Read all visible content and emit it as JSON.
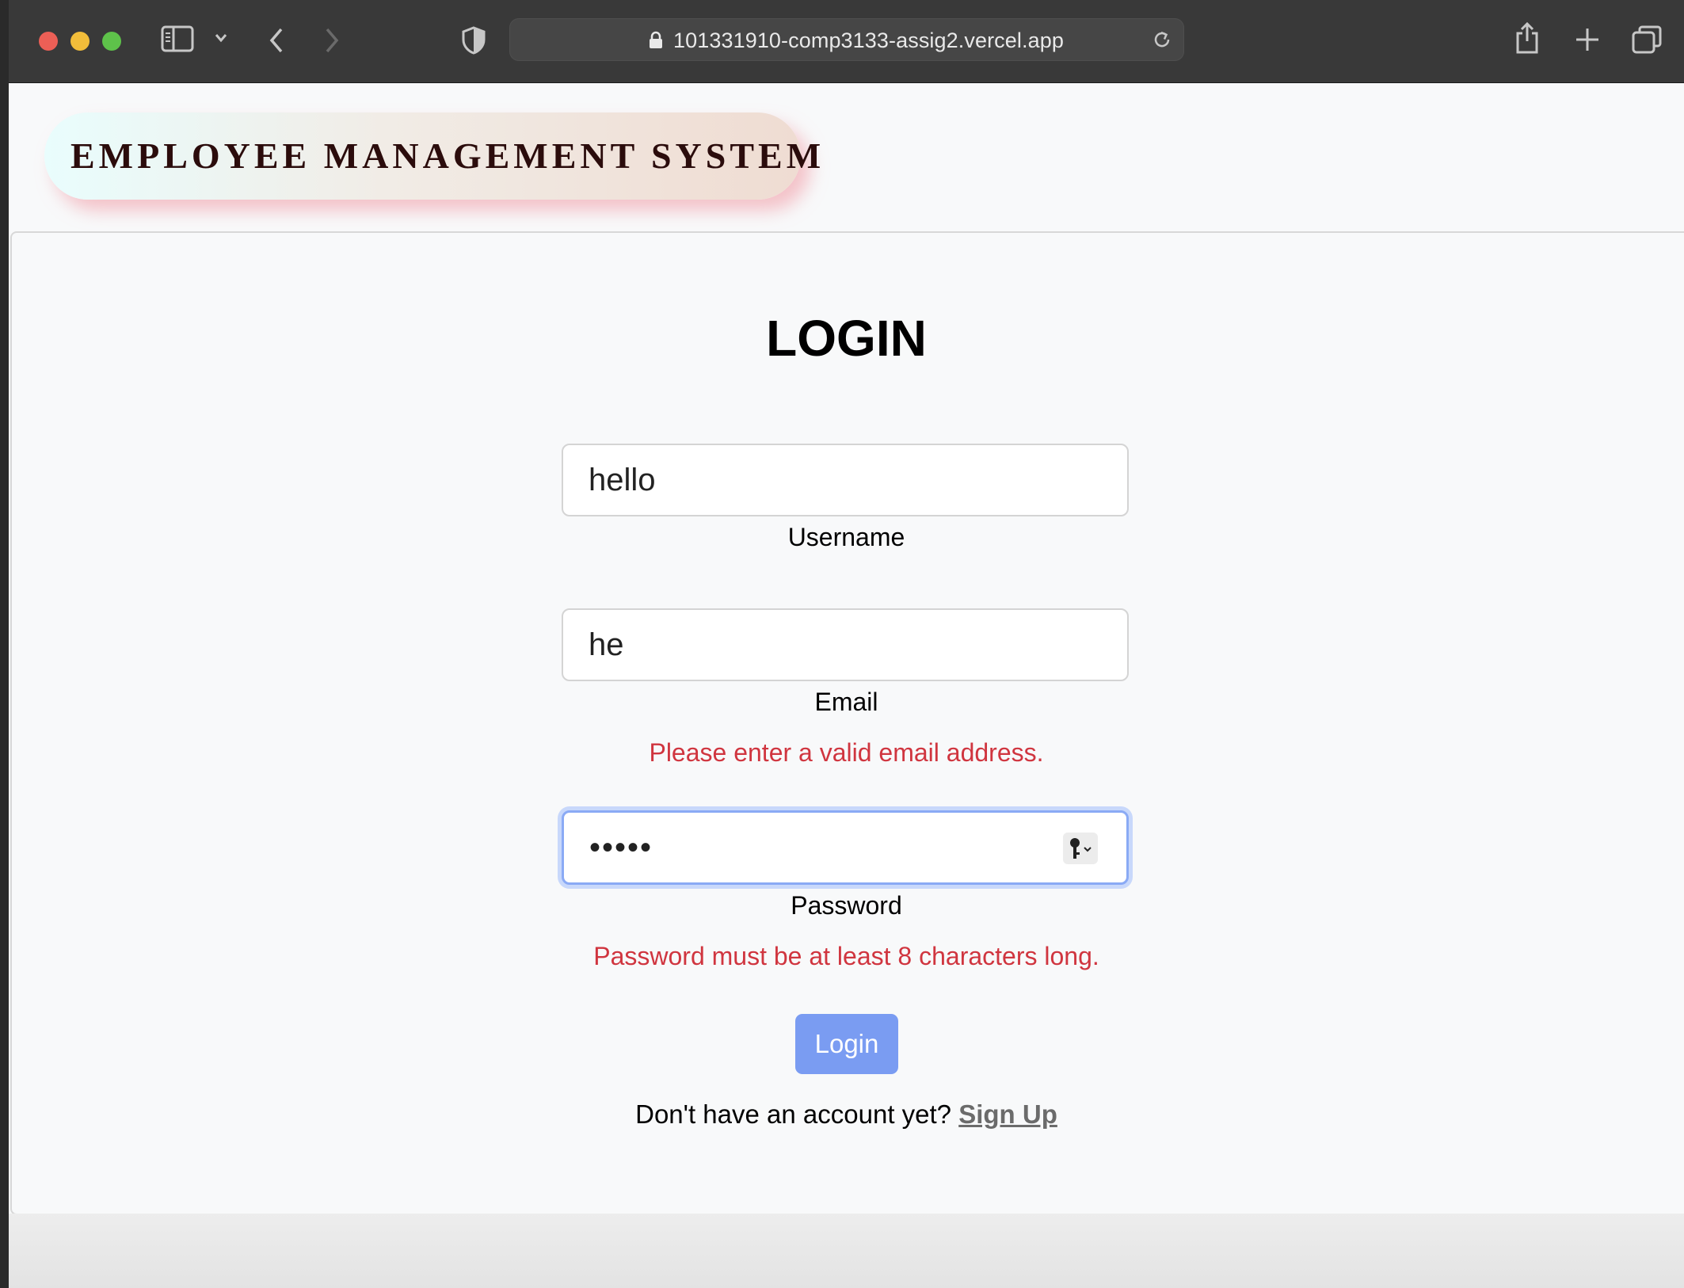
{
  "browser": {
    "url": "101331910-comp3133-assig2.vercel.app"
  },
  "header": {
    "title": "EMPLOYEE MANAGEMENT SYSTEM"
  },
  "form": {
    "title": "LOGIN",
    "username": {
      "value": "hello",
      "label": "Username"
    },
    "email": {
      "value": "he",
      "label": "Email",
      "error": "Please enter a valid email address."
    },
    "password": {
      "value": "•••••",
      "label": "Password",
      "error": "Password must be at least 8 characters long."
    },
    "submit_label": "Login",
    "signup_prompt": "Don't have an account yet?",
    "signup_link": "Sign Up"
  },
  "colors": {
    "error": "#d0353f",
    "button": "#7a9cf2",
    "toolbar": "#393939"
  }
}
